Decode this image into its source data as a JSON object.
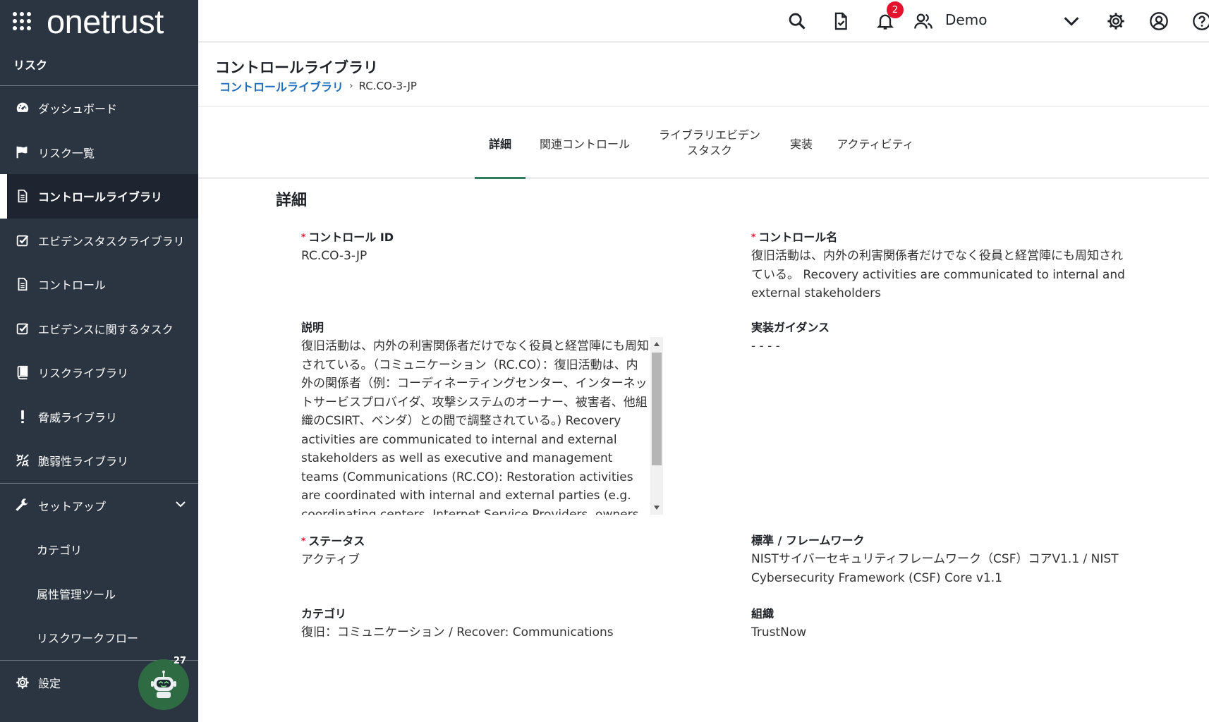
{
  "brand": {
    "name": "onetrust"
  },
  "sidebar": {
    "module": "リスク",
    "items": [
      {
        "label": "ダッシュボード",
        "icon": "dashboard-icon"
      },
      {
        "label": "リスク一覧",
        "icon": "flag-icon"
      },
      {
        "label": "コントロールライブラリ",
        "icon": "document-icon",
        "active": true
      },
      {
        "label": "エビデンスタスクライブラリ",
        "icon": "checkbox-icon"
      },
      {
        "label": "コントロール",
        "icon": "document-icon"
      },
      {
        "label": "エビデンスに関するタスク",
        "icon": "checkbox-icon"
      },
      {
        "label": "リスクライブラリ",
        "icon": "book-icon"
      },
      {
        "label": "脅威ライブラリ",
        "icon": "exclamation-icon"
      },
      {
        "label": "脆弱性ライブラリ",
        "icon": "bug-icon"
      }
    ],
    "setup": {
      "label": "セットアップ",
      "items": [
        "カテゴリ",
        "属性管理ツール",
        "リスクワークフロー"
      ]
    },
    "settings": "設定",
    "bot_badge": "27"
  },
  "topbar": {
    "notification_count": "2",
    "user_name": "Demo"
  },
  "header": {
    "title": "コントロールライブラリ",
    "breadcrumb_link": "コントロールライブラリ",
    "breadcrumb_current": "RC.CO-3-JP"
  },
  "tabs": [
    {
      "label": "詳細",
      "active": true
    },
    {
      "label": "関連コントロール"
    },
    {
      "label_line1": "ライブラリエビデン",
      "label_line2": "スタスク"
    },
    {
      "label": "実装"
    },
    {
      "label": "アクティビティ"
    }
  ],
  "details": {
    "section_title": "詳細",
    "control_id_label": "コントロール ID",
    "control_id_value": "RC.CO-3-JP",
    "control_name_label": "コントロール名",
    "control_name_value": "復旧活動は、内外の利害関係者だけでなく役員と経営陣にも周知されている。 Recovery activities are communicated to internal and external stakeholders",
    "description_label": "説明",
    "description_value": "復旧活動は、内外の利害関係者だけでなく役員と経営陣にも周知されている。（コミュニケーション（RC.CO）：復旧活動は、内外の関係者（例：コーディネーティングセンター、インターネットサービスプロバイダ、攻撃システムのオーナー、被害者、他組織のCSIRT、ベンダ）との間で調整されている。) Recovery activities are communicated to internal and external stakeholders as well as executive and management teams (Communications (RC.CO): Restoration activities are coordinated with internal and external parties (e.g. coordinating centers, Internet Service Providers, owners of",
    "guidance_label": "実装ガイダンス",
    "guidance_value": "- - - -",
    "status_label": "ステータス",
    "status_value": "アクティブ",
    "framework_label": "標準 / フレームワーク",
    "framework_value": "NISTサイバーセキュリティフレームワーク（CSF）コアV1.1 / NIST Cybersecurity Framework (CSF) Core v1.1",
    "category_label": "カテゴリ",
    "category_value": "復旧：コミュニケーション / Recover: Communications",
    "org_label": "組織",
    "org_value": "TrustNow"
  }
}
